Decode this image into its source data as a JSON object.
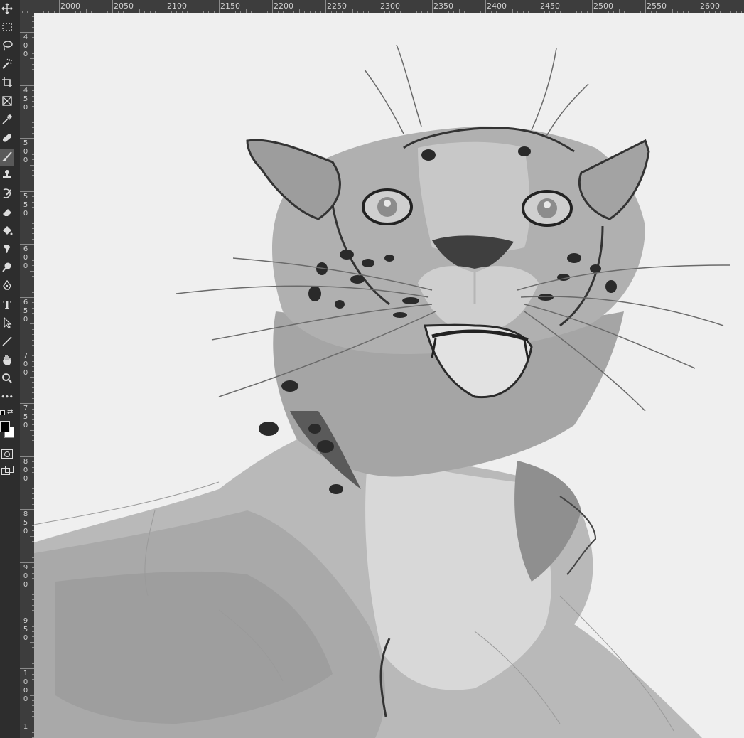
{
  "tools": [
    {
      "name": "move-tool",
      "icon": "move-icon"
    },
    {
      "name": "marquee-tool",
      "icon": "marquee-icon"
    },
    {
      "name": "lasso-tool",
      "icon": "lasso-icon"
    },
    {
      "name": "magic-wand-tool",
      "icon": "magic-wand-icon"
    },
    {
      "name": "crop-tool",
      "icon": "crop-icon"
    },
    {
      "name": "frame-tool",
      "icon": "frame-icon"
    },
    {
      "name": "eyedropper-tool",
      "icon": "eyedropper-icon"
    },
    {
      "name": "healing-brush-tool",
      "icon": "bandage-icon"
    },
    {
      "name": "brush-tool",
      "icon": "brush-icon",
      "active": true
    },
    {
      "name": "clone-stamp-tool",
      "icon": "stamp-icon"
    },
    {
      "name": "history-brush-tool",
      "icon": "history-brush-icon"
    },
    {
      "name": "eraser-tool",
      "icon": "eraser-icon"
    },
    {
      "name": "paint-bucket-tool",
      "icon": "paint-bucket-icon"
    },
    {
      "name": "smudge-tool",
      "icon": "smudge-icon"
    },
    {
      "name": "dodge-tool",
      "icon": "dodge-icon"
    },
    {
      "name": "pen-tool",
      "icon": "pen-icon"
    },
    {
      "name": "type-tool",
      "icon": "type-icon",
      "label": "T"
    },
    {
      "name": "path-selection-tool",
      "icon": "arrow-icon"
    },
    {
      "name": "line-tool",
      "icon": "line-icon"
    },
    {
      "name": "hand-tool",
      "icon": "hand-icon"
    },
    {
      "name": "zoom-tool",
      "icon": "zoom-icon"
    },
    {
      "name": "more-tools",
      "icon": "ellipsis-icon",
      "label": "•••"
    }
  ],
  "colors": {
    "foreground": "#000000",
    "background": "#ffffff",
    "ui_dark": "#2d2d2d",
    "ruler": "#3d3d3d",
    "canvas": "#efefef"
  },
  "ruler_h_labels": [
    "2000",
    "2050",
    "2100",
    "2150",
    "2200",
    "2250",
    "2300",
    "2350",
    "2400",
    "2450",
    "2500",
    "2550",
    "2600"
  ],
  "ruler_v_labels": [
    [
      "4",
      "0",
      "0"
    ],
    [
      "4",
      "5",
      "0"
    ],
    [
      "5",
      "0",
      "0"
    ],
    [
      "5",
      "5",
      "0"
    ],
    [
      "6",
      "0",
      "0"
    ],
    [
      "6",
      "5",
      "0"
    ],
    [
      "7",
      "0",
      "0"
    ],
    [
      "7",
      "5",
      "0"
    ],
    [
      "8",
      "0",
      "0"
    ],
    [
      "8",
      "5",
      "0"
    ],
    [
      "9",
      "0",
      "0"
    ],
    [
      "9",
      "5",
      "0"
    ],
    [
      "1",
      "0",
      "0",
      "0"
    ],
    [
      "1"
    ]
  ]
}
